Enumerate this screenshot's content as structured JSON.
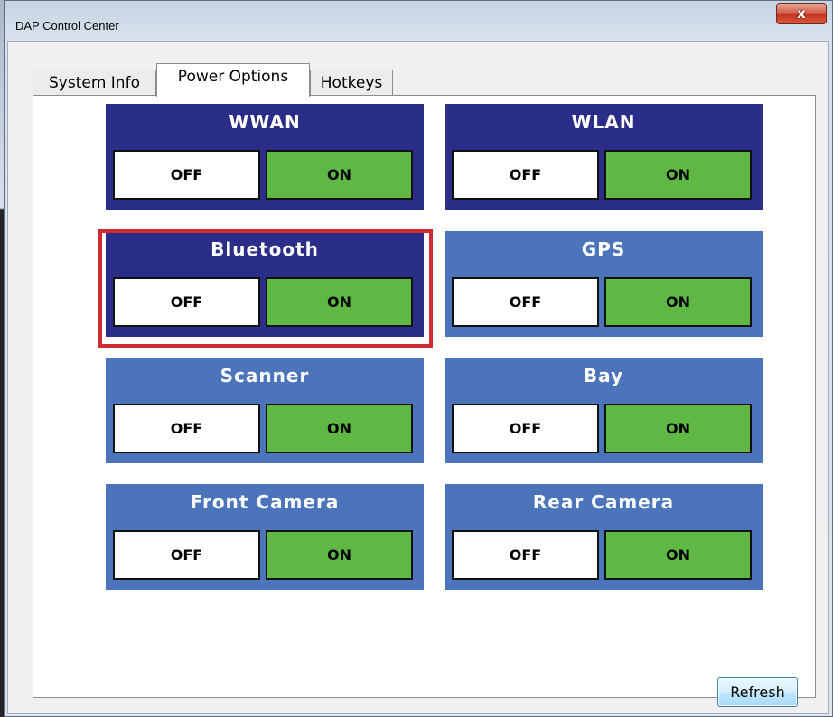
{
  "window": {
    "title": "DAP Control Center",
    "close_icon": "close-icon",
    "close_glyph": "x"
  },
  "tabs": [
    {
      "label": "System Info",
      "selected": false
    },
    {
      "label": "Power Options",
      "selected": true
    },
    {
      "label": "Hotkeys",
      "selected": false
    }
  ],
  "devices": [
    {
      "name": "WWAN",
      "off_label": "OFF",
      "on_label": "ON",
      "highlighted": false
    },
    {
      "name": "WLAN",
      "off_label": "OFF",
      "on_label": "ON",
      "highlighted": false
    },
    {
      "name": "Bluetooth",
      "off_label": "OFF",
      "on_label": "ON",
      "highlighted": true
    },
    {
      "name": "GPS",
      "off_label": "OFF",
      "on_label": "ON",
      "highlighted": false
    },
    {
      "name": "Scanner",
      "off_label": "OFF",
      "on_label": "ON",
      "highlighted": false
    },
    {
      "name": "Bay",
      "off_label": "OFF",
      "on_label": "ON",
      "highlighted": false
    },
    {
      "name": "Front Camera",
      "off_label": "OFF",
      "on_label": "ON",
      "highlighted": false
    },
    {
      "name": "Rear Camera",
      "off_label": "OFF",
      "on_label": "ON",
      "highlighted": false
    }
  ],
  "actions": {
    "refresh_label": "Refresh"
  },
  "colors": {
    "card_dark": "#2b2e88",
    "card_light": "#4b74ba",
    "on_button": "#5fb844",
    "off_button": "#ffffff",
    "highlight_border": "#cf2c32"
  }
}
